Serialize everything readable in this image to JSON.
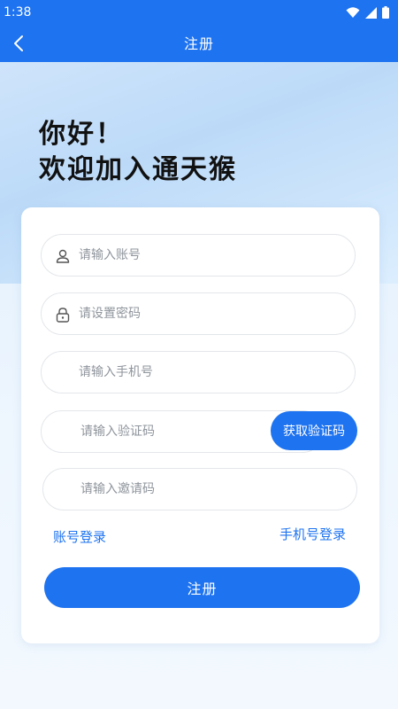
{
  "status": {
    "time": "1:38"
  },
  "nav": {
    "title": "注册"
  },
  "greeting": {
    "line1": "你好！",
    "line2": "欢迎加入通天猴"
  },
  "form": {
    "account_placeholder": "请输入账号",
    "password_placeholder": "请设置密码",
    "phone_placeholder": "请输入手机号",
    "code_placeholder": "请输入验证码",
    "invite_placeholder": "请输入邀请码",
    "get_code_label": "获取验证码",
    "account_login_label": "账号登录",
    "phone_login_label": "手机号登录",
    "submit_label": "注册"
  },
  "colors": {
    "accent": "#1e73f0",
    "background": "#e4f1fd"
  },
  "icons": {
    "back": "chevron-left-icon",
    "user": "user-icon",
    "lock": "lock-icon",
    "wifi": "wifi-icon",
    "signal": "signal-icon",
    "battery": "battery-icon"
  }
}
